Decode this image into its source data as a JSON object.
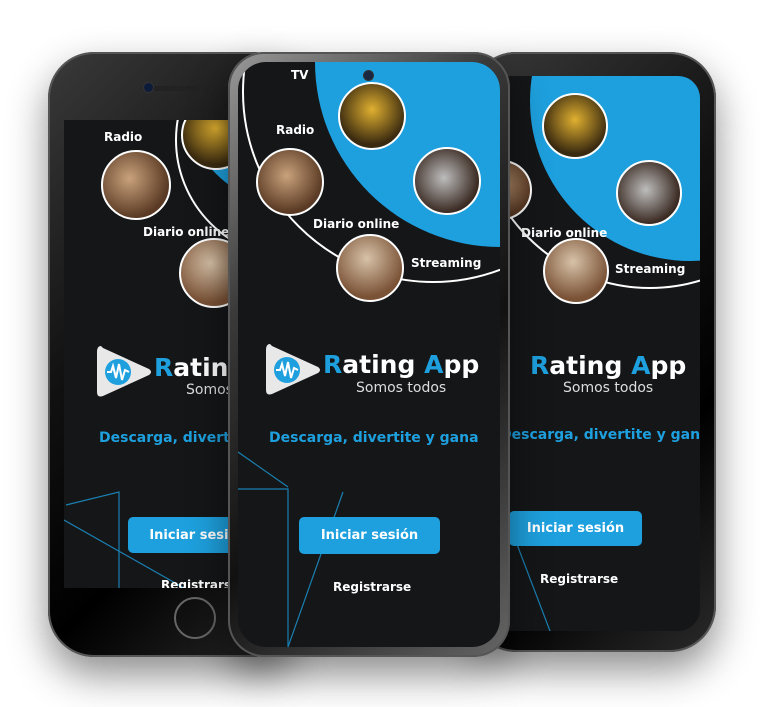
{
  "app": {
    "brand_initial_1": "R",
    "brand_word_1": "ating",
    "brand_initial_2": "A",
    "brand_word_2": "pp",
    "subtitle": "Somos todos",
    "tagline": "Descarga, divertite y gana"
  },
  "media_labels": {
    "tv": "TV",
    "radio": "Radio",
    "diario": "Diario online",
    "streaming": "Streaming"
  },
  "buttons": {
    "login": "Iniciar sesión",
    "register": "Registrarse"
  },
  "colors": {
    "accent": "#1ea0de",
    "background": "#151618",
    "text": "#ffffff"
  },
  "icons": [
    "play-logo-icon",
    "waveform-icon"
  ]
}
